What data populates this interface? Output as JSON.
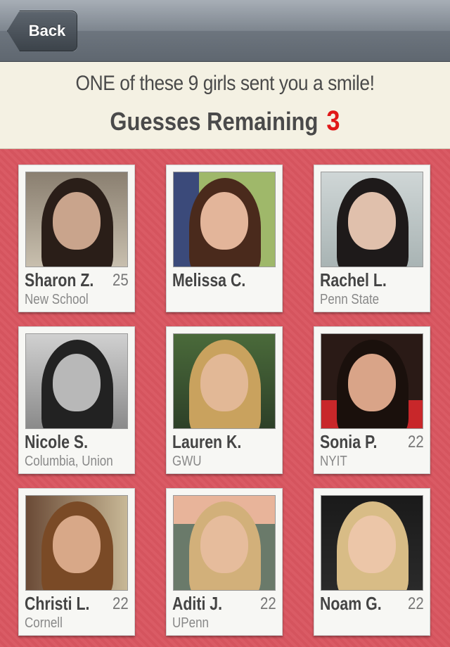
{
  "nav": {
    "back_label": "Back"
  },
  "banner": {
    "line1": "ONE of these 9 girls sent you a smile!",
    "guesses_label": "Guesses Remaining",
    "guesses_count": "3"
  },
  "colors": {
    "accent_red": "#e01818",
    "grid_background": "#d95660",
    "banner_background": "#f4f1e3"
  },
  "profiles": [
    {
      "name": "Sharon Z.",
      "age": "25",
      "school": "New School"
    },
    {
      "name": "Melissa C.",
      "age": "",
      "school": ""
    },
    {
      "name": "Rachel L.",
      "age": "",
      "school": "Penn State"
    },
    {
      "name": "Nicole S.",
      "age": "",
      "school": "Columbia, Union"
    },
    {
      "name": "Lauren K.",
      "age": "",
      "school": "GWU"
    },
    {
      "name": "Sonia P.",
      "age": "22",
      "school": "NYIT"
    },
    {
      "name": "Christi L.",
      "age": "22",
      "school": "Cornell"
    },
    {
      "name": "Aditi J.",
      "age": "22",
      "school": "UPenn"
    },
    {
      "name": "Noam G.",
      "age": "22",
      "school": ""
    }
  ]
}
